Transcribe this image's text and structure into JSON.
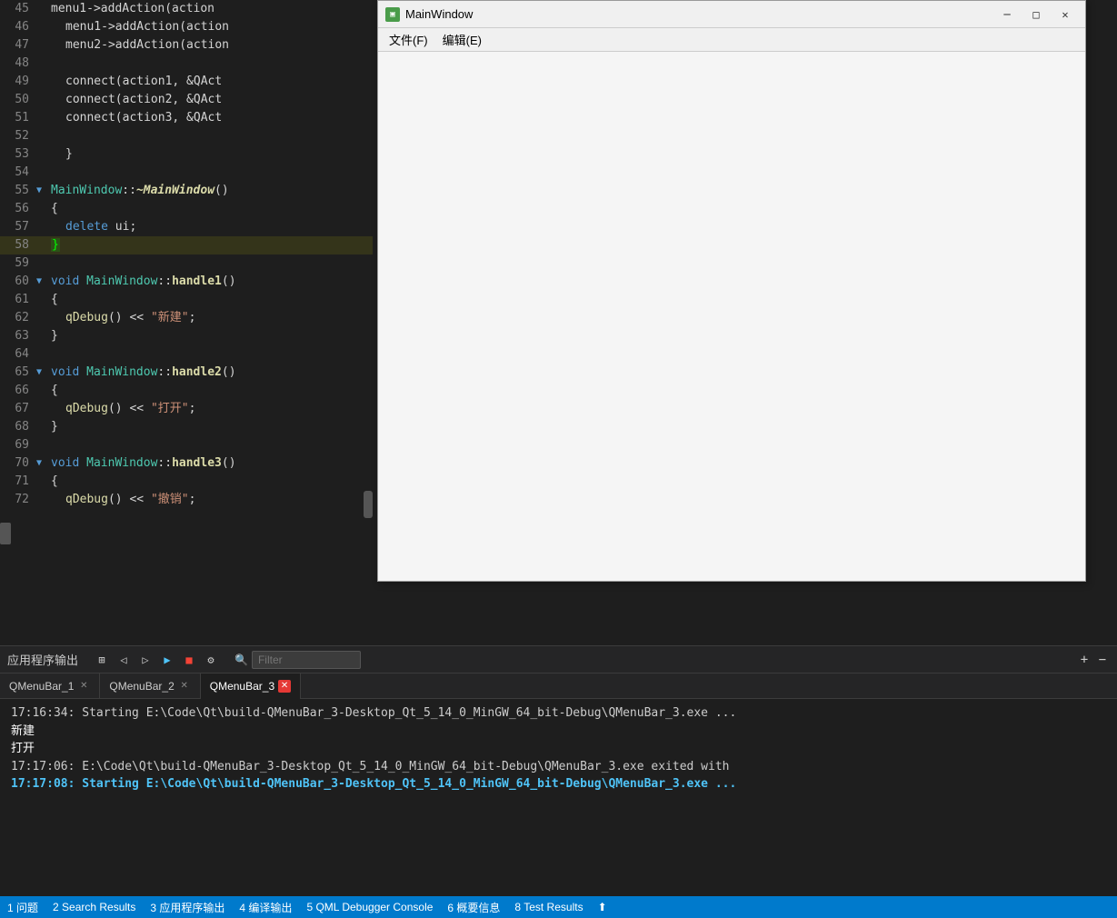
{
  "editor": {
    "lines": [
      {
        "num": "45",
        "indent": 0,
        "fold": false,
        "content": "menu1->addAction(action"
      },
      {
        "num": "46",
        "indent": 1,
        "fold": false,
        "content": "menu1->addAction(action"
      },
      {
        "num": "47",
        "indent": 1,
        "fold": false,
        "content": "menu2->addAction(action"
      },
      {
        "num": "48",
        "indent": 0,
        "fold": false,
        "content": ""
      },
      {
        "num": "49",
        "indent": 1,
        "fold": false,
        "content": "connect(action1, &QAct"
      },
      {
        "num": "50",
        "indent": 1,
        "fold": false,
        "content": "connect(action2, &QAct"
      },
      {
        "num": "51",
        "indent": 1,
        "fold": false,
        "content": "connect(action3, &QAct"
      },
      {
        "num": "52",
        "indent": 0,
        "fold": false,
        "content": ""
      },
      {
        "num": "53",
        "indent": 1,
        "fold": false,
        "content": "}"
      },
      {
        "num": "54",
        "indent": 0,
        "fold": false,
        "content": ""
      },
      {
        "num": "55",
        "indent": 0,
        "fold": true,
        "content": "MainWindow::~MainWindow()"
      },
      {
        "num": "56",
        "indent": 0,
        "fold": false,
        "content": "{"
      },
      {
        "num": "57",
        "indent": 1,
        "fold": false,
        "content": "delete ui;"
      },
      {
        "num": "58",
        "indent": 0,
        "fold": false,
        "content": "}",
        "highlight": true
      },
      {
        "num": "59",
        "indent": 0,
        "fold": false,
        "content": ""
      },
      {
        "num": "60",
        "indent": 0,
        "fold": true,
        "content": "void MainWindow::handle1()"
      },
      {
        "num": "61",
        "indent": 0,
        "fold": false,
        "content": "{"
      },
      {
        "num": "62",
        "indent": 1,
        "fold": false,
        "content": "qDebug() << \"新建\";"
      },
      {
        "num": "63",
        "indent": 0,
        "fold": false,
        "content": "}"
      },
      {
        "num": "64",
        "indent": 0,
        "fold": false,
        "content": ""
      },
      {
        "num": "65",
        "indent": 0,
        "fold": true,
        "content": "void MainWindow::handle2()"
      },
      {
        "num": "66",
        "indent": 0,
        "fold": false,
        "content": "{"
      },
      {
        "num": "67",
        "indent": 1,
        "fold": false,
        "content": "qDebug() << \"打开\";"
      },
      {
        "num": "68",
        "indent": 0,
        "fold": false,
        "content": "}"
      },
      {
        "num": "69",
        "indent": 0,
        "fold": false,
        "content": ""
      },
      {
        "num": "70",
        "indent": 0,
        "fold": true,
        "content": "void MainWindow::handle3()"
      },
      {
        "num": "71",
        "indent": 0,
        "fold": false,
        "content": "{"
      },
      {
        "num": "72",
        "indent": 1,
        "fold": false,
        "content": "qDebug() << \"撤销\";"
      }
    ]
  },
  "qt_window": {
    "title": "MainWindow",
    "icon": "▣",
    "menu_items": [
      "文件(F)",
      "编辑(E)"
    ],
    "min_label": "─",
    "max_label": "□",
    "close_label": "✕"
  },
  "bottom_panel": {
    "title": "应用程序输出",
    "filter_placeholder": "Filter",
    "plus_label": "+",
    "minus_label": "−",
    "tabs": [
      {
        "label": "QMenuBar_1",
        "active": false,
        "closeable": false
      },
      {
        "label": "QMenuBar_2",
        "active": false,
        "closeable": false
      },
      {
        "label": "QMenuBar_3",
        "active": true,
        "closeable": true
      }
    ],
    "output_lines": [
      {
        "text": "17:16:34: Starting E:\\Code\\Qt\\build-QMenuBar_3-Desktop_Qt_5_14_0_MinGW_64_bit-Debug\\QMenuBar_3.exe ...",
        "style": "normal"
      },
      {
        "text": "新建",
        "style": "white"
      },
      {
        "text": "打开",
        "style": "white"
      },
      {
        "text": "17:17:06: E:\\Code\\Qt\\build-QMenuBar_3-Desktop_Qt_5_14_0_MinGW_64_bit-Debug\\QMenuBar_3.exe exited with",
        "style": "normal"
      },
      {
        "text": "",
        "style": "normal"
      },
      {
        "text": "17:17:08: Starting E:\\Code\\Qt\\build-QMenuBar_3-Desktop_Qt_5_14_0_MinGW_64_bit-Debug\\QMenuBar_3.exe ...",
        "style": "bold-blue"
      }
    ]
  },
  "status_bar": {
    "items": [
      "1 问题",
      "2 Search Results",
      "3 应用程序输出",
      "4 编译输出",
      "5 QML Debugger Console",
      "6 概要信息",
      "8 Test Results",
      "⬆"
    ]
  }
}
